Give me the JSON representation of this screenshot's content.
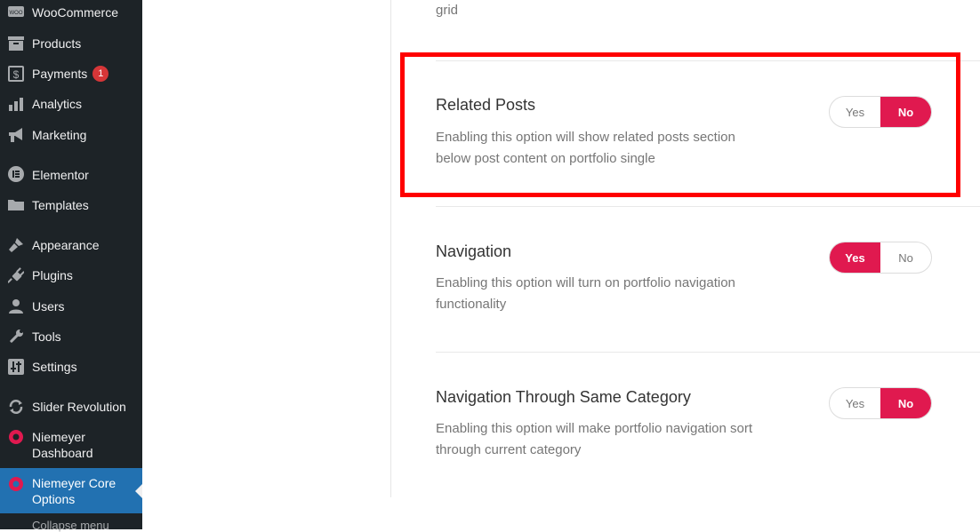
{
  "sidebar": {
    "items": [
      {
        "label": "WooCommerce",
        "icon": "woo-icon"
      },
      {
        "label": "Products",
        "icon": "archive-icon"
      },
      {
        "label": "Payments",
        "icon": "dollar-icon",
        "badge": "1"
      },
      {
        "label": "Analytics",
        "icon": "bar-chart-icon"
      },
      {
        "label": "Marketing",
        "icon": "megaphone-icon"
      },
      {
        "label": "Elementor",
        "icon": "elementor-icon"
      },
      {
        "label": "Templates",
        "icon": "folder-icon"
      },
      {
        "label": "Appearance",
        "icon": "paintbrush-icon"
      },
      {
        "label": "Plugins",
        "icon": "plug-icon"
      },
      {
        "label": "Users",
        "icon": "user-icon"
      },
      {
        "label": "Tools",
        "icon": "wrench-icon"
      },
      {
        "label": "Settings",
        "icon": "sliders-icon"
      },
      {
        "label": "Slider Revolution",
        "icon": "refresh-icon"
      },
      {
        "label": "Niemeyer Dashboard",
        "icon": "niemeyer-icon"
      },
      {
        "label": "Niemeyer Core Options",
        "icon": "niemeyer-icon",
        "active": true
      }
    ],
    "collapse_label": "Collapse menu"
  },
  "content": {
    "previous_desc_tail": "grid",
    "options": [
      {
        "title": "Related Posts",
        "description": "Enabling this option will show related posts section below post content on portfolio single",
        "yes_label": "Yes",
        "no_label": "No",
        "selected": "No"
      },
      {
        "title": "Navigation",
        "description": "Enabling this option will turn on portfolio navigation functionality",
        "yes_label": "Yes",
        "no_label": "No",
        "selected": "Yes"
      },
      {
        "title": "Navigation Through Same Category",
        "description": "Enabling this option will make portfolio navigation sort through current category",
        "yes_label": "Yes",
        "no_label": "No",
        "selected": "No"
      }
    ]
  },
  "colors": {
    "sidebar_bg": "#1d2327",
    "active_item": "#2271b1",
    "toggle_on": "#e0194f",
    "highlight": "#ff0000"
  }
}
